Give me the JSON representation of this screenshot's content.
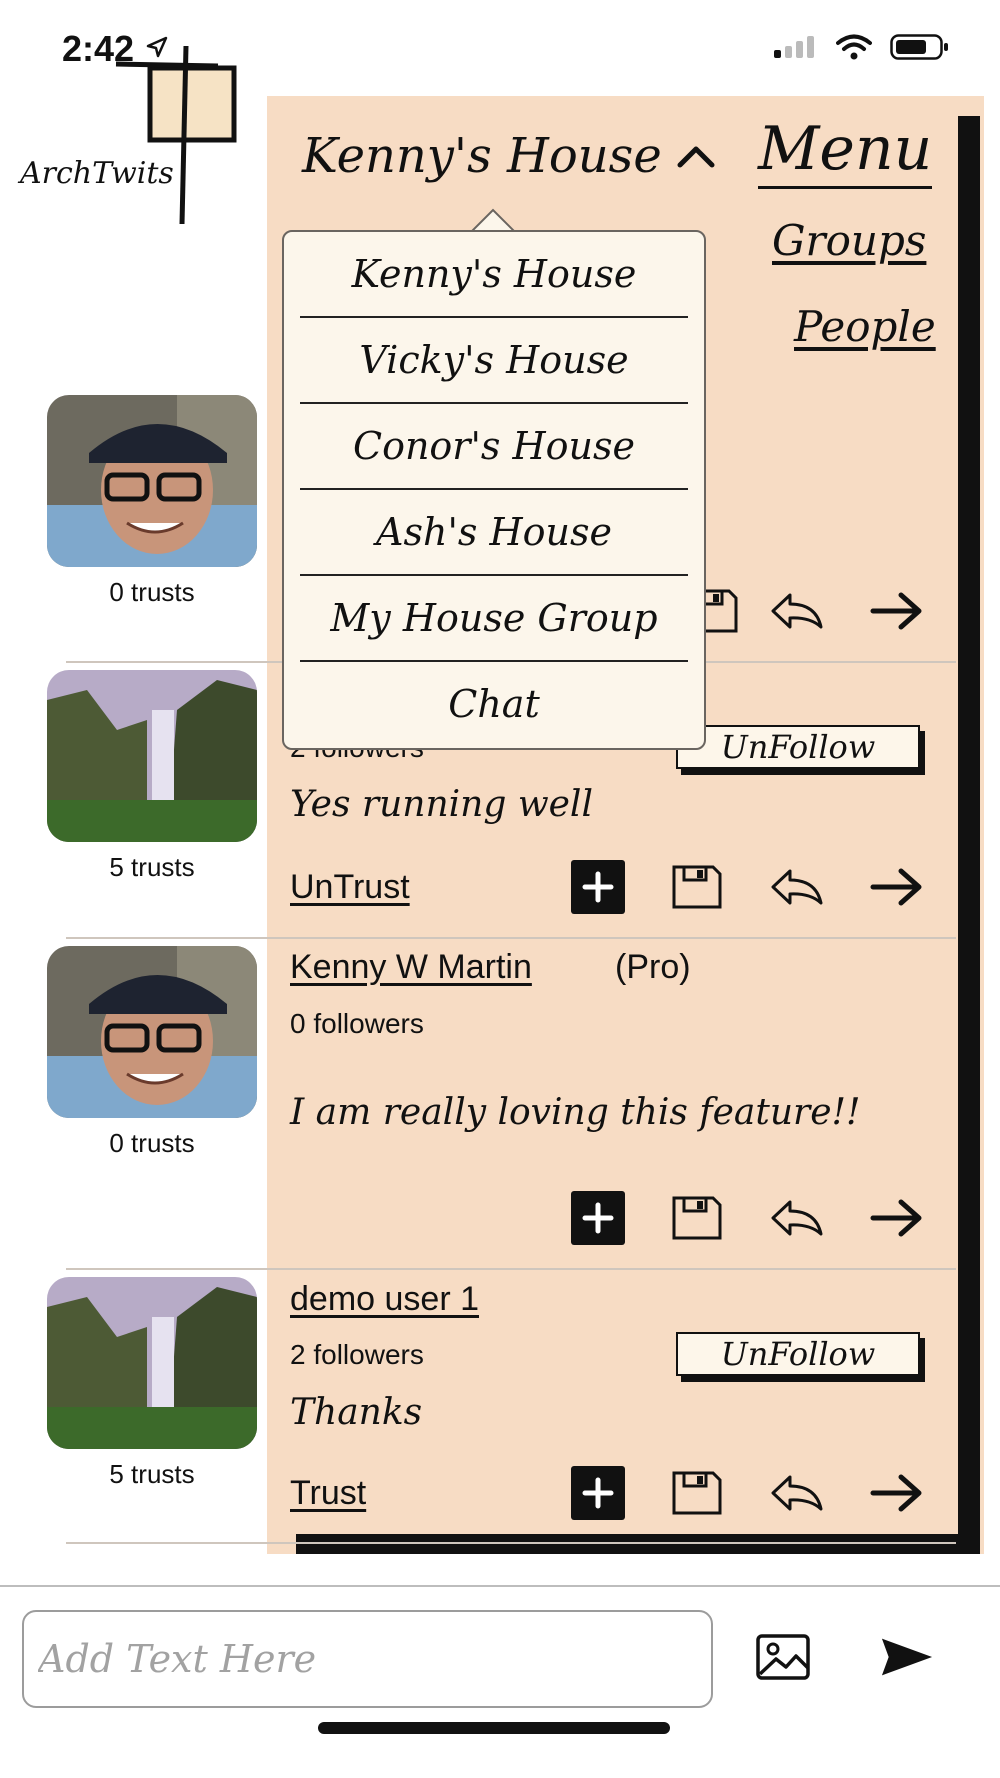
{
  "status_bar": {
    "time": "2:42"
  },
  "logo": {
    "text": "ArchTwits"
  },
  "header": {
    "group_title": "Kenny's House",
    "menu_title": "Menu",
    "menu_links": [
      "Groups",
      "People"
    ]
  },
  "dropdown": {
    "items": [
      "Kenny's House",
      "Vicky's House",
      "Conor's House",
      "Ash's House",
      "My House Group",
      "Chat"
    ]
  },
  "posts": [
    {
      "trusts": "0 trusts",
      "avatar": "person-photo"
    },
    {
      "trusts": "5 trusts",
      "avatar": "waterfall-photo",
      "followers": "2 followers",
      "follow_button": "UnFollow",
      "text": "Yes running well",
      "trust_link": "UnTrust"
    },
    {
      "trusts": "0 trusts",
      "avatar": "person-photo",
      "name": "Kenny W Martin",
      "badge": "(Pro)",
      "followers": "0 followers",
      "text": "I am really loving this feature!!"
    },
    {
      "trusts": "5 trusts",
      "avatar": "waterfall-photo",
      "name": "demo user 1",
      "followers": "2 followers",
      "follow_button": "UnFollow",
      "text": "Thanks",
      "trust_link": "Trust"
    }
  ],
  "composer": {
    "placeholder": "Add Text Here"
  },
  "icons": {
    "add": "plus-icon",
    "save": "floppy-disk-icon",
    "reply": "reply-icon",
    "forward": "arrow-right-icon",
    "image": "image-icon",
    "send": "send-icon"
  },
  "colors": {
    "panel": "#f7dcc4",
    "dropdown": "#fcf6eb",
    "button_bg": "#fdf6ea",
    "dark": "#111111"
  }
}
